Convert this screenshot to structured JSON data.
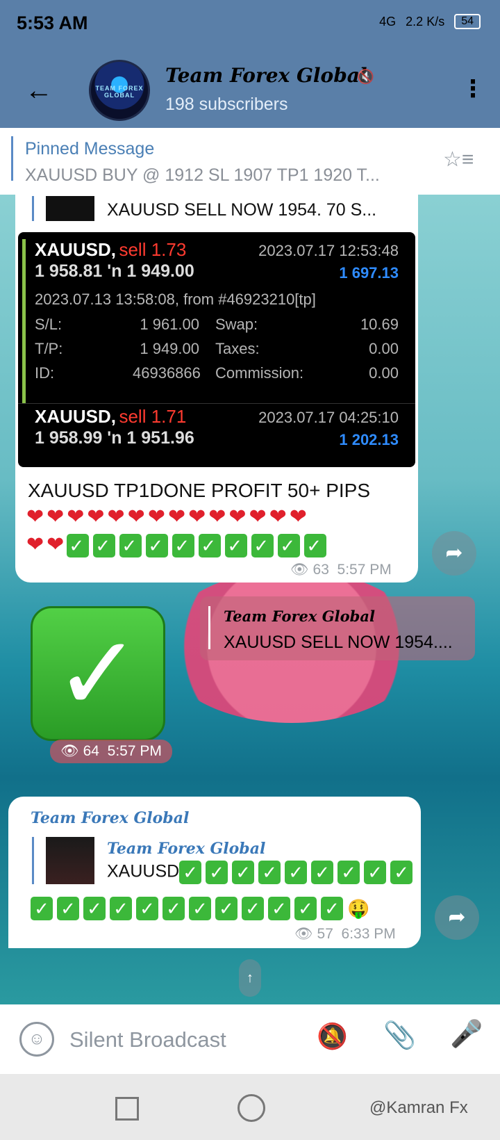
{
  "status": {
    "time": "5:53 AM",
    "network": "4G",
    "speed": "2.2 K/s",
    "battery": "54"
  },
  "header": {
    "back_icon": "arrow-left",
    "avatar_text": "TEAM FOREX GLOBAL",
    "title": "Team Forex Global",
    "subtitle": "198 subscribers",
    "menu_icon": "more-vertical"
  },
  "pinned": {
    "title": "Pinned Message",
    "text": "XAUUSD BUY @ 1912    SL 1907  TP1 1920 T..."
  },
  "msg1": {
    "reply_text": "XAUUSD SELL NOW 1954. 70     S...",
    "trade": {
      "row1_symbol": "XAUUSD,",
      "row1_action": "sell 1.73",
      "row1_time": "2023.07.17 12:53:48",
      "row1_prices": "1 958.81 'n 1 949.00",
      "row1_profit": "1 697.13",
      "detail_line": "2023.07.13 13:58:08, from #46923210[tp]",
      "sl_label": "S/L:",
      "sl_value": "1 961.00",
      "swap_label": "Swap:",
      "swap_value": "10.69",
      "tp_label": "T/P:",
      "tp_value": "1 949.00",
      "taxes_label": "Taxes:",
      "taxes_value": "0.00",
      "id_label": "ID:",
      "id_value": "46936866",
      "comm_label": "Commission:",
      "comm_value": "0.00",
      "row2_symbol": "XAUUSD,",
      "row2_action": "sell 1.71",
      "row2_time": "2023.07.17 04:25:10",
      "row2_prices": "1 958.99 'n 1 951.96",
      "row2_profit": "1 202.13"
    },
    "text": "XAUUSD TP1DONE PROFIT 50+ PIPS",
    "hearts_line1": "❤❤❤❤❤❤❤❤❤❤❤❤❤❤",
    "hearts_line2": "❤❤",
    "views": "63",
    "time": "5:57 PM"
  },
  "sticker": {
    "views": "64",
    "time": "5:57 PM",
    "check": "✓"
  },
  "forward": {
    "title": "Team Forex Global",
    "text": "XAUUSD SELL NOW 1954...."
  },
  "msg2": {
    "title": "Team Forex Global",
    "reply_title": "Team Forex Global",
    "reply_text": "XAUUSD",
    "emoji_end": "🤑",
    "views": "57",
    "time": "6:33 PM"
  },
  "input": {
    "placeholder": "Silent Broadcast"
  },
  "watermark": "@Kamran Fx"
}
